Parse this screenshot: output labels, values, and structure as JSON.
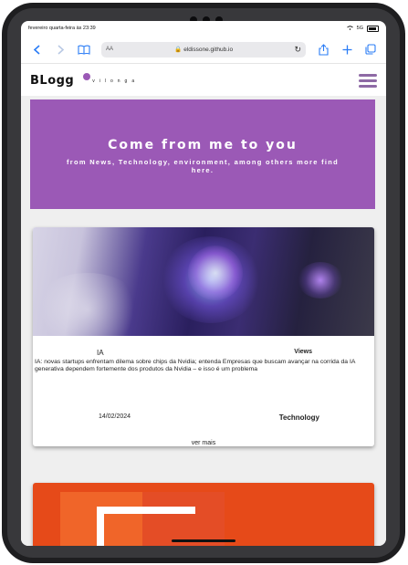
{
  "statusbar": {
    "datetime": "fevereiro quarta-feira às 23:39",
    "signal": "5G"
  },
  "browser": {
    "aa_label": "AA",
    "url": "eldissone.github.io"
  },
  "site": {
    "logo_main": "BLogg",
    "logo_sub": "vilonga"
  },
  "hero": {
    "title": "Come from me to you",
    "subtitle": "from News, Technology, environment, among others more find here."
  },
  "posts": [
    {
      "title": "IA",
      "views_label": "Views",
      "description": "IA: novas startups enfrentam dilema sobre chips da Nvidia; entenda Empresas que buscam avançar na corrida da IA generativa dependem fortemente dos produtos da Nvidia – e isso é um problema",
      "date": "14/02/2024",
      "category": "Technology",
      "more_label": "ver mais"
    }
  ],
  "colors": {
    "accent": "#9b59b6",
    "link_blue": "#2a7cf6",
    "background": "#efefef"
  },
  "icons": [
    "back-icon",
    "forward-icon",
    "bookmarks-icon",
    "lock-icon",
    "reload-icon",
    "share-icon",
    "new-tab-icon",
    "tabs-icon",
    "menu-icon"
  ]
}
